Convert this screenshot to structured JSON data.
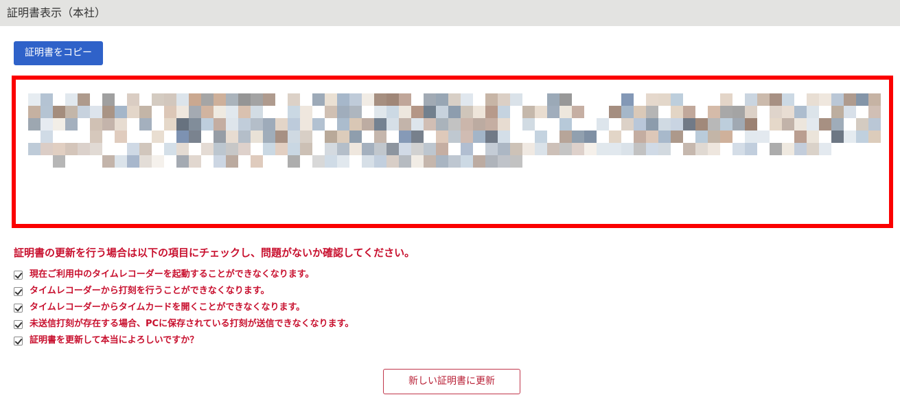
{
  "header": {
    "title": "証明書表示（本社）"
  },
  "toolbar": {
    "copy_label": "証明書をコピー"
  },
  "certificate": {
    "content": "",
    "redacted": true,
    "frame_color": "#fb0000"
  },
  "notice": {
    "text": "証明書の更新を行う場合は以下の項目にチェックし、問題がないか確認してください。"
  },
  "checklist": [
    {
      "label": "現在ご利用中のタイムレコーダーを起動することができなくなります。",
      "checked": true
    },
    {
      "label": "タイムレコーダーから打刻を行うことができなくなります。",
      "checked": true
    },
    {
      "label": "タイムレコーダーからタイムカードを開くことができなくなります。",
      "checked": true
    },
    {
      "label": "未送信打刻が存在する場合、PCに保存されている打刻が送信できなくなります。",
      "checked": true
    },
    {
      "label": "証明書を更新して本当によろしいですか？",
      "checked": true
    }
  ],
  "actions": {
    "renew_label": "新しい証明書に更新"
  },
  "colors": {
    "header_bg": "#e3e3e1",
    "primary_button": "#2f62c9",
    "warning_text": "#c8102e",
    "renew_border": "#c0354a"
  }
}
